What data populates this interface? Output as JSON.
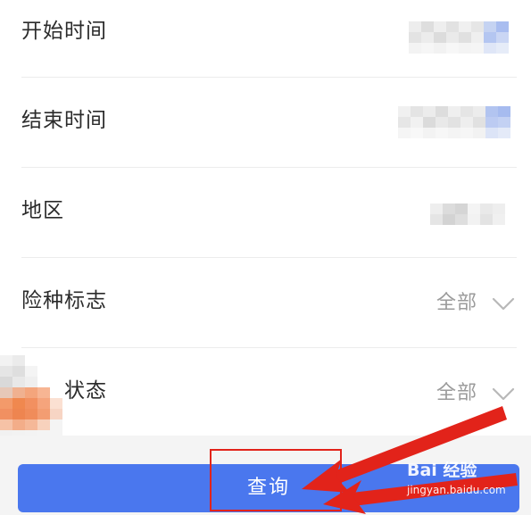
{
  "form": {
    "rows": [
      {
        "label": "开始时间",
        "value": "",
        "has_chevron": false
      },
      {
        "label": "结束时间",
        "value": "",
        "has_chevron": false
      },
      {
        "label": "地区",
        "value": "",
        "has_chevron": false
      },
      {
        "label": "险种标志",
        "value": "全部",
        "has_chevron": true
      },
      {
        "label": "缴费状态",
        "value": "全部",
        "has_chevron": true
      }
    ]
  },
  "actions": {
    "query_label": "查询"
  },
  "watermark": {
    "logo_text": "Bai 经验",
    "url_text": "jingyan.baidu.com"
  },
  "colors": {
    "primary_button": "#4a77ee",
    "annotation_red": "#e2231a",
    "label_text": "#2b2b2b",
    "value_text": "#9b9b9b"
  },
  "icons": {
    "dropdown": "chevron-down-icon"
  }
}
